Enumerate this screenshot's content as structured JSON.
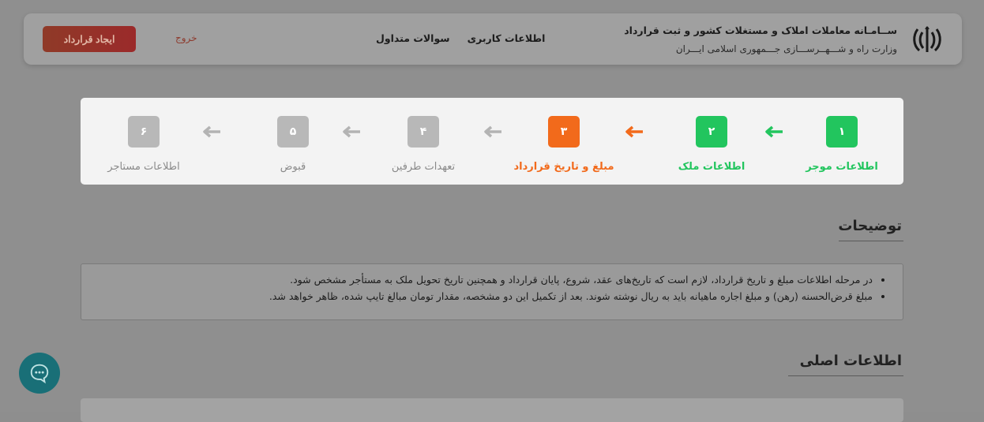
{
  "header": {
    "title_main": "ســامـانه معاملات املاک و مستغلات کشور و ثبت قرارداد",
    "title_sub": "وزارت راه و شـــهــرســـازی جـــمهوری اسلامی ایـــران",
    "nav": [
      "اطلاعات کاربری",
      "سوالات متداول"
    ],
    "logout": "خروج",
    "create_contract": "ایجاد قرارداد",
    "logo_icon": "iran-emblem-icon"
  },
  "steps": [
    {
      "num": "۱",
      "label": "اطلاعات موجر",
      "state": "done",
      "color": "#22c55e"
    },
    {
      "num": "۲",
      "label": "اطلاعات ملک",
      "state": "done",
      "color": "#22c55e"
    },
    {
      "num": "۳",
      "label": "مبلغ و تاریخ قرارداد",
      "state": "active",
      "color": "#f26a1b"
    },
    {
      "num": "۴",
      "label": "تعهدات طرفین",
      "state": "pending",
      "color": "#b8b8b8"
    },
    {
      "num": "۵",
      "label": "قبوض",
      "state": "pending",
      "color": "#b8b8b8"
    },
    {
      "num": "۶",
      "label": "اطلاعات مستاجر",
      "state": "pending",
      "color": "#b8b8b8"
    }
  ],
  "description": {
    "title": "توضیحات",
    "items": [
      "در مرحله اطلاعات مبلغ و تاریخ قرارداد، لازم است که تاریخ‌های عقد، شروع، پایان قرارداد و همچنین تاریخ تحویل ملک به مستأجر مشخص شود.",
      "مبلغ قرض‌الحسنه (رهن) و مبلغ اجاره ماهیانه باید به ریال نوشته شوند. بعد از تکمیل این دو مشخصه، مقدار تومان مبالغ تایپ شده، ظاهر خواهد شد."
    ]
  },
  "main_info": {
    "title": "اطلاعات اصلی"
  },
  "chat": {
    "icon": "chat-bubble-icon"
  }
}
